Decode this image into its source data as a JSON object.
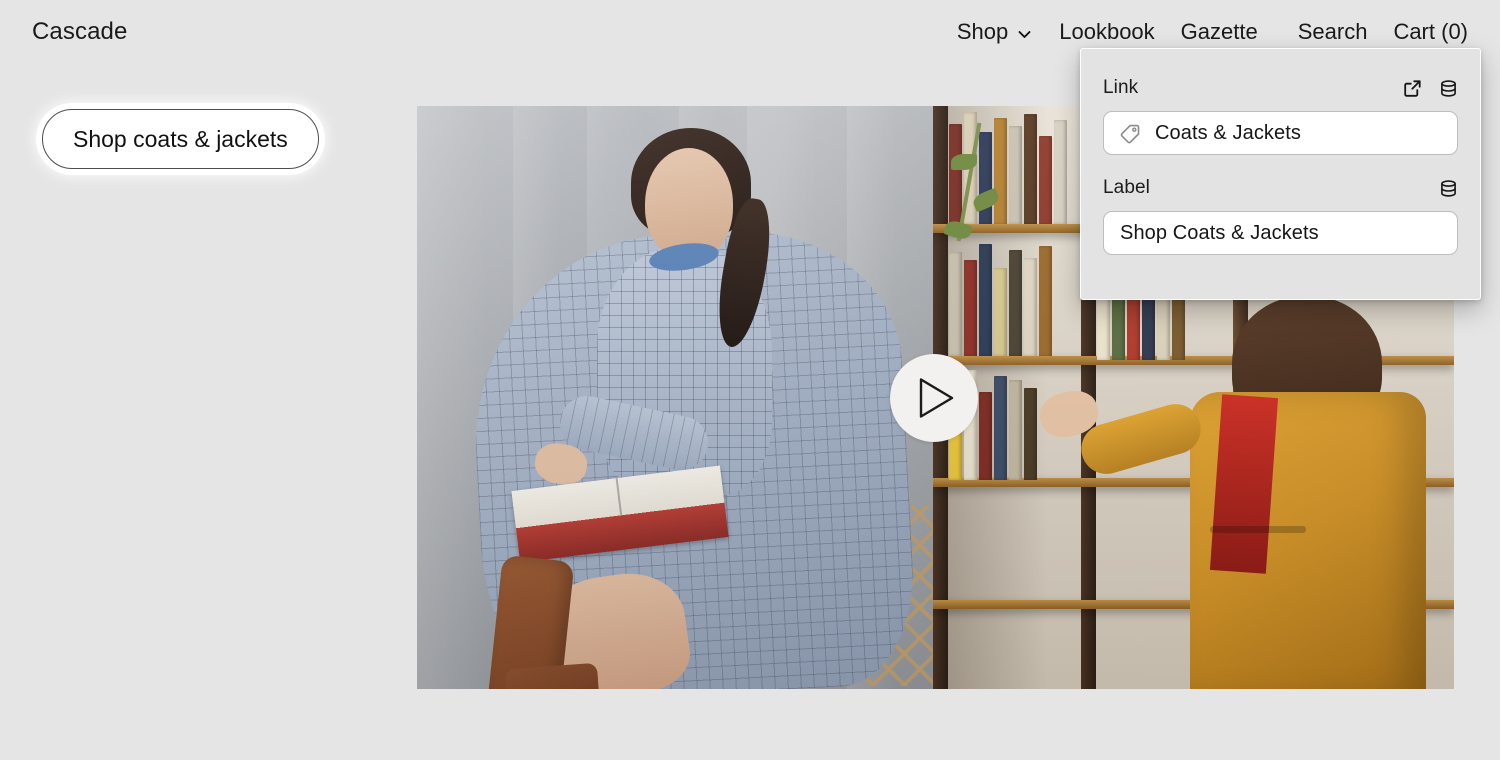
{
  "site": {
    "brand": "Cascade",
    "nav": [
      {
        "label": "Shop",
        "icon": "chevron-down-icon",
        "has_chevron": true
      },
      {
        "label": "Lookbook",
        "has_chevron": false
      },
      {
        "label": "Gazette",
        "has_chevron": false
      },
      {
        "label": "Search",
        "has_chevron": false
      },
      {
        "label": "Cart (0)",
        "has_chevron": false
      }
    ]
  },
  "hero": {
    "cta_label": "Shop coats & jackets",
    "play_button_icon": "play-icon"
  },
  "editor_popover": {
    "fields": [
      {
        "label": "Link",
        "value": "Coats & Jackets",
        "value_icon": "tag-icon",
        "actions": [
          "external-link-icon",
          "database-icon"
        ]
      },
      {
        "label": "Label",
        "value": "Shop Coats & Jackets",
        "actions": [
          "database-icon"
        ]
      }
    ]
  },
  "colors": {
    "page_background": "#e5e5e5",
    "popover_background": "#e3e3e3",
    "input_background": "#ffffff",
    "text": "#111111",
    "input_border": "#bdbdbd"
  }
}
